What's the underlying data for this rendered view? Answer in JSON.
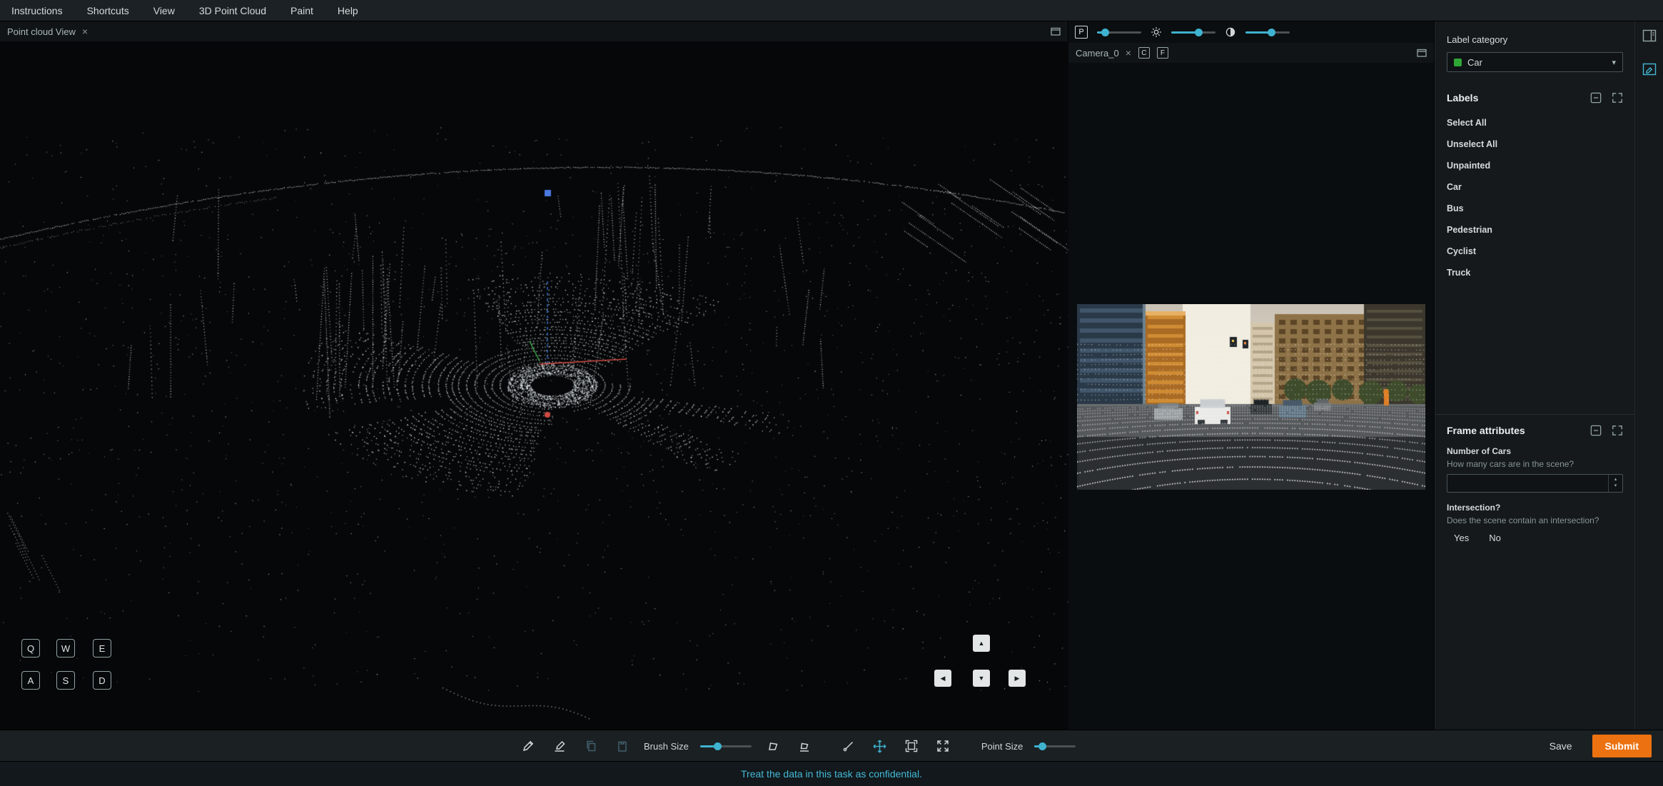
{
  "menu": {
    "items": [
      "Instructions",
      "Shortcuts",
      "View",
      "3D Point Cloud",
      "Paint",
      "Help"
    ]
  },
  "pointcloud": {
    "tab": "Point cloud View"
  },
  "camera": {
    "tab": "Camera_0",
    "p": "P",
    "c": "C",
    "f": "F"
  },
  "keys": {
    "q": "Q",
    "w": "W",
    "e": "E",
    "a": "A",
    "s": "S",
    "d": "D"
  },
  "icons": {
    "close": "×",
    "chevron_down": "▾",
    "step_up": "▴",
    "step_down": "▾",
    "nav_up": "▲",
    "nav_down": "▼",
    "nav_left": "◀",
    "nav_right": "▶"
  },
  "sidebar": {
    "label_category_heading": "Label category",
    "category_selected": "Car",
    "labels_heading": "Labels",
    "label_items": [
      "Select All",
      "Unselect All",
      "Unpainted",
      "Car",
      "Bus",
      "Pedestrian",
      "Cyclist",
      "Truck"
    ],
    "frame_attributes_heading": "Frame attributes",
    "cars_label": "Number of Cars",
    "cars_question": "How many cars are in the scene?",
    "cars_value": "",
    "intersection_label": "Intersection?",
    "intersection_question": "Does the scene contain an intersection?",
    "yes": "Yes",
    "no": "No"
  },
  "toolbar": {
    "brush_size": "Brush Size",
    "point_size": "Point Size",
    "save": "Save",
    "submit": "Submit"
  },
  "status": {
    "confidential": "Treat the data in this task as confidential."
  },
  "colors": {
    "accent": "#3fb2cf",
    "submit_orange": "#ec7211",
    "status_teal": "#44b9d6",
    "car_swatch": "#2fa836"
  }
}
